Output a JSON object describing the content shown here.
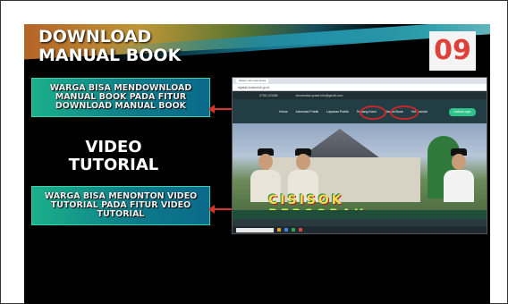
{
  "slide": {
    "title_line1": "DOWNLOAD",
    "title_line2": "MANUAL BOOK",
    "slide_number": "09",
    "box_manual": "WARGA BISA MENDOWNLOAD\nMANUAL BOOK PADA FITUR\nDOWNLOAD MANUAL BOOK",
    "video_line1": "VIDEO",
    "video_line2": "TUTORIAL",
    "box_video": "WARGA BISA MENONTON VIDEO\nTUTORIAL PADA FITUR VIDEO\nTUTORIAL"
  },
  "screenshot": {
    "tab_label": "Sistem Informasi Desa",
    "address": "sigalak.kotasolok.go.id",
    "info_phone": "0755-123456",
    "info_email": "kecamatan.pusat.info@gmail.com",
    "nav_items": [
      "Home",
      "Informasi Publik",
      "Layanan Publik",
      "Tentang Kami",
      "Manual Book",
      "Vid Tutorial"
    ],
    "nav_button": "Daftar/Login",
    "banner_text": "CISISOK BERSORAK"
  },
  "colors": {
    "arrow": "#d8322a",
    "box_gradient_start": "#1bb08a",
    "box_gradient_end": "#0a6a8a",
    "number_color": "#e0403a"
  }
}
